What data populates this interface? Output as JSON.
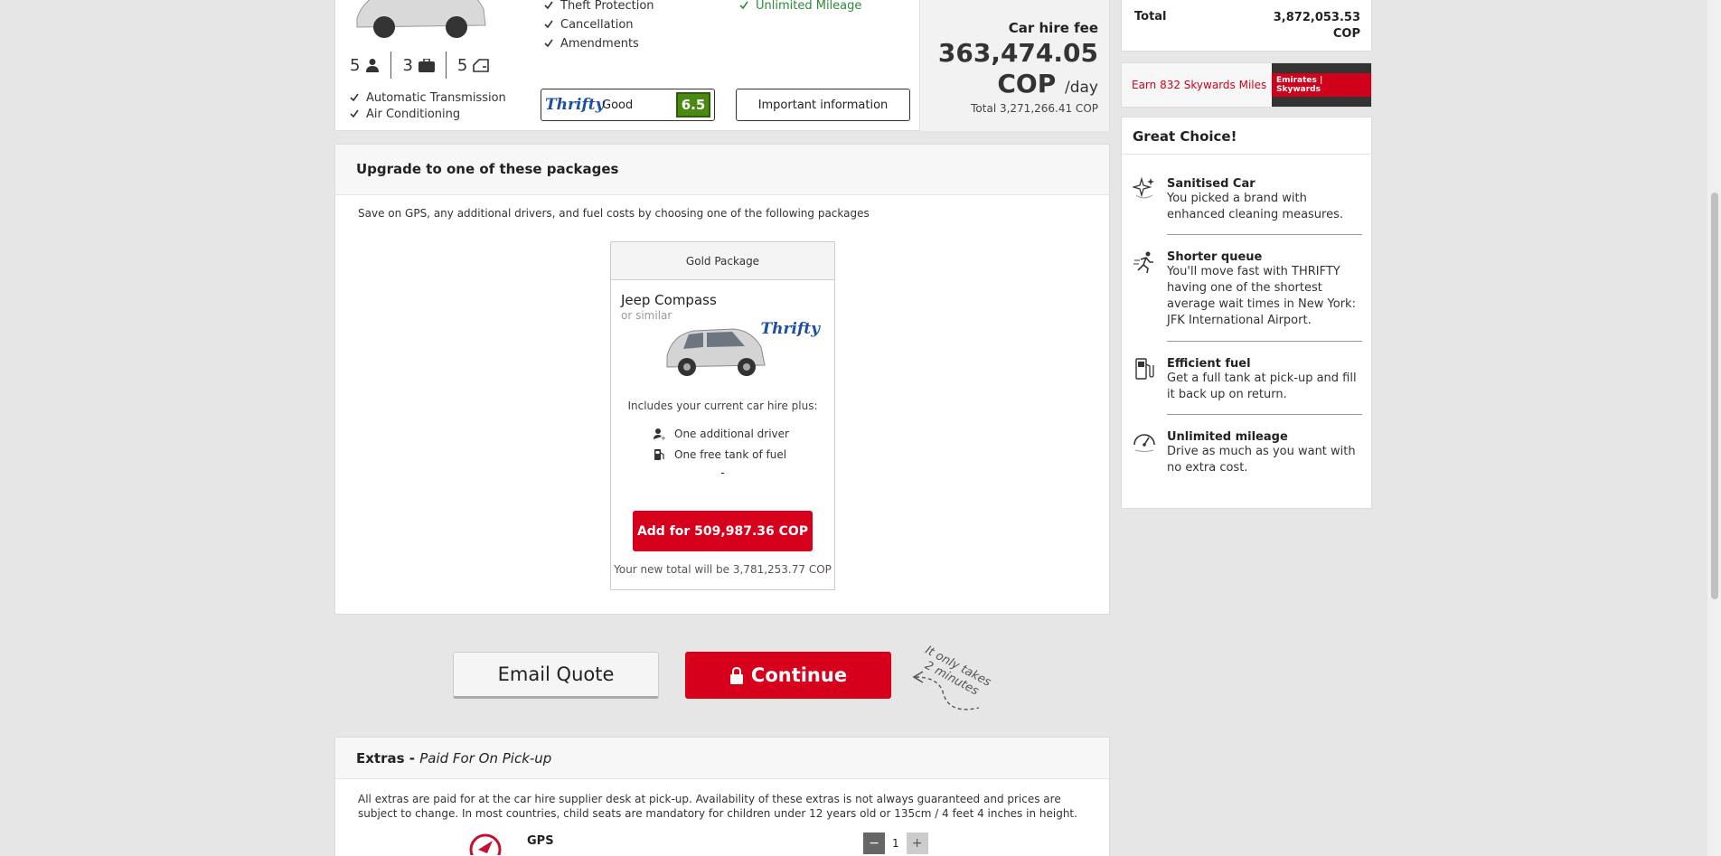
{
  "car": {
    "specs": {
      "passengers": "5",
      "bags": "3",
      "doors": "5"
    },
    "features_left": [
      "Automatic Transmission",
      "Air Conditioning"
    ],
    "features_mid": [
      "Theft Protection",
      "Cancellation",
      "Amendments"
    ],
    "features_right": [
      "Unlimited Mileage"
    ],
    "supplier_logo": "Thrifty",
    "rating_word": "Good",
    "rating_score": "6.5",
    "important_info_label": "Important information",
    "fee_label": "Car hire fee",
    "fee_amount": "363,474.05",
    "fee_currency": "COP",
    "fee_per": "/day",
    "fee_total": "Total 3,271,266.41 COP"
  },
  "sidebar": {
    "total_label": "Total",
    "total_value_line1": "3,872,053.53",
    "total_value_line2": "COP",
    "skywards_text": "Earn 832 Skywards Miles",
    "skywards_brand": "Emirates | Skywards",
    "choice_title": "Great Choice!",
    "choices": [
      {
        "title": "Sanitised Car",
        "desc": "You picked a brand with enhanced cleaning measures."
      },
      {
        "title": "Shorter queue",
        "desc": "You'll move fast with THRIFTY having one of the shortest average wait times in New York: JFK International Airport."
      },
      {
        "title": "Efficient fuel",
        "desc": "Get a full tank at pick-up and fill it back up on return."
      },
      {
        "title": "Unlimited mileage",
        "desc": "Drive as much as you want with no extra cost."
      }
    ]
  },
  "upgrade": {
    "title": "Upgrade to one of these packages",
    "subtitle": "Save on GPS, any additional drivers, and fuel costs by choosing one of the following packages",
    "package": {
      "name": "Gold Package",
      "model": "Jeep Compass",
      "similar": "or similar",
      "brand": "Thrifty",
      "includes": "Includes your current car hire plus:",
      "items": [
        "One additional driver",
        "One free tank of fuel"
      ],
      "dash": "-",
      "add_label": "Add for 509,987.36 COP",
      "new_total": "Your new total will be 3,781,253.77 COP"
    }
  },
  "actions": {
    "email_label": "Email Quote",
    "continue_label": "Continue",
    "hint_line1": "It only takes",
    "hint_line2": "2 minutes"
  },
  "extras": {
    "title": "Extras",
    "title_sep": " - ",
    "title_sub": "Paid For On Pick-up",
    "desc": "All extras are paid for at the car hire supplier desk at pick-up. Availability of these extras is not always guaranteed and prices are subject to change. In most countries, child seats are mandatory for children under 12 years old or 135cm / 4 feet 4 inches in height.",
    "gps_label": "GPS",
    "gps_qty": "1",
    "minus": "−",
    "plus": "+"
  }
}
